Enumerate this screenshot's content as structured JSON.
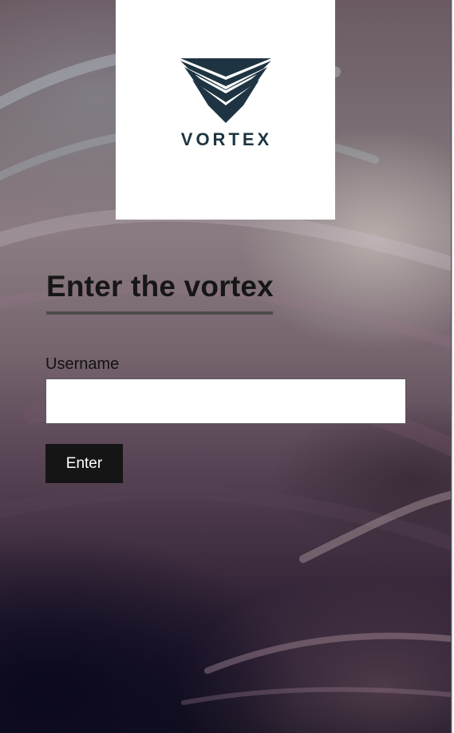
{
  "logo": {
    "name": "VORTEX",
    "icon": "vortex-chevron-logo",
    "color": "#1e3442"
  },
  "login": {
    "heading": "Enter the vortex",
    "username_label": "Username",
    "username_value": "",
    "username_placeholder": "",
    "submit_label": "Enter"
  },
  "colors": {
    "button_bg": "#151515",
    "button_text": "#ffffff",
    "heading_text": "#161616",
    "underline": "#4e4c4a"
  }
}
